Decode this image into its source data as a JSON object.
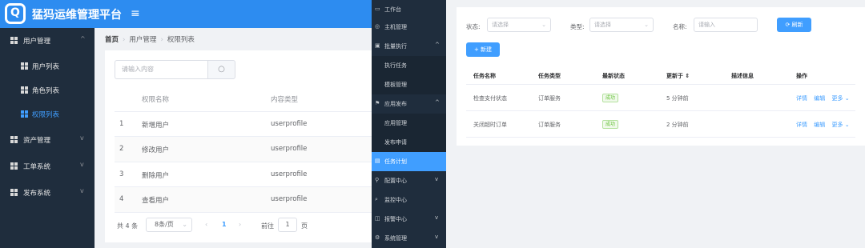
{
  "panel1": {
    "logo_char": "Q",
    "app_title": "猛犸运维管理平台",
    "menu_toggle": "≡",
    "sidebar": [
      {
        "label": "用户管理",
        "chevron": "^",
        "type": "group"
      },
      {
        "label": "用户列表",
        "type": "sub"
      },
      {
        "label": "角色列表",
        "type": "sub"
      },
      {
        "label": "权限列表",
        "type": "sub",
        "active": true
      },
      {
        "label": "资产管理",
        "chevron": "v",
        "type": "group"
      },
      {
        "label": "工单系统",
        "chevron": "v",
        "type": "group"
      },
      {
        "label": "发布系统",
        "chevron": "v",
        "type": "group"
      }
    ],
    "breadcrumb": [
      "首页",
      "用户管理",
      "权限列表"
    ],
    "breadcrumb_sep": "›",
    "search_placeholder": "请输入内容",
    "search_icon": "search-icon",
    "table": {
      "headers": [
        "",
        "权限名称",
        "内容类型"
      ],
      "rows": [
        [
          "1",
          "新增用户",
          "userprofile"
        ],
        [
          "2",
          "修改用户",
          "userprofile"
        ],
        [
          "3",
          "删除用户",
          "userprofile"
        ],
        [
          "4",
          "查看用户",
          "userprofile"
        ]
      ]
    },
    "pager": {
      "total": "共 4 条",
      "page_size": "8条/页",
      "dropdown": "⌄",
      "prev": "‹",
      "current": "1",
      "next": "›",
      "goto_label": "前往",
      "goto_value": "1",
      "page_suffix": "页"
    }
  },
  "panel2": {
    "menu": [
      {
        "icon": "monitor-icon",
        "glyph": "▭",
        "label": "工作台",
        "type": "top"
      },
      {
        "icon": "server-icon",
        "glyph": "◎",
        "label": "主机管理",
        "type": "top"
      },
      {
        "icon": "batch-icon",
        "glyph": "▣",
        "label": "批量执行",
        "chevron": "^",
        "type": "group"
      },
      {
        "label": "执行任务",
        "type": "sub"
      },
      {
        "label": "模板管理",
        "type": "sub"
      },
      {
        "icon": "flag-icon",
        "glyph": "⚑",
        "label": "应用发布",
        "chevron": "^",
        "type": "group"
      },
      {
        "label": "应用管理",
        "type": "sub"
      },
      {
        "label": "发布申请",
        "type": "sub"
      },
      {
        "icon": "calendar-icon",
        "glyph": "▤",
        "label": "任务计划",
        "type": "top",
        "active": true
      },
      {
        "icon": "config-icon",
        "glyph": "⚲",
        "label": "配置中心",
        "chevron": "v",
        "type": "group"
      },
      {
        "icon": "monitor-center-icon",
        "glyph": "⌕",
        "label": "监控中心",
        "type": "top"
      },
      {
        "icon": "alarm-icon",
        "glyph": "◫",
        "label": "报警中心",
        "chevron": "v",
        "type": "group"
      },
      {
        "icon": "gear-icon",
        "glyph": "⚙",
        "label": "系统管理",
        "chevron": "v",
        "type": "group"
      }
    ]
  },
  "panel3": {
    "filters": {
      "status_label": "状态:",
      "status_placeholder": "请选择",
      "type_label": "类型:",
      "type_placeholder": "请选择",
      "name_label": "名称:",
      "name_placeholder": "请输入",
      "dropdown": "⌄",
      "refresh_label": "⟳ 刷新"
    },
    "new_button": "+ 新建",
    "table": {
      "headers": [
        "任务名称",
        "任务类型",
        "最新状态",
        "更新于 ⇕",
        "描述信息",
        "操作"
      ],
      "rows": [
        {
          "name": "检查支付状态",
          "type": "订单服务",
          "status": "成功",
          "updated": "5 分钟前",
          "desc": "",
          "ops": [
            "详情",
            "编辑",
            "更多 ⌄"
          ]
        },
        {
          "name": "关闭超时订单",
          "type": "订单服务",
          "status": "成功",
          "updated": "2 分钟前",
          "desc": "",
          "ops": [
            "详情",
            "编辑",
            "更多 ⌄"
          ]
        }
      ]
    }
  }
}
